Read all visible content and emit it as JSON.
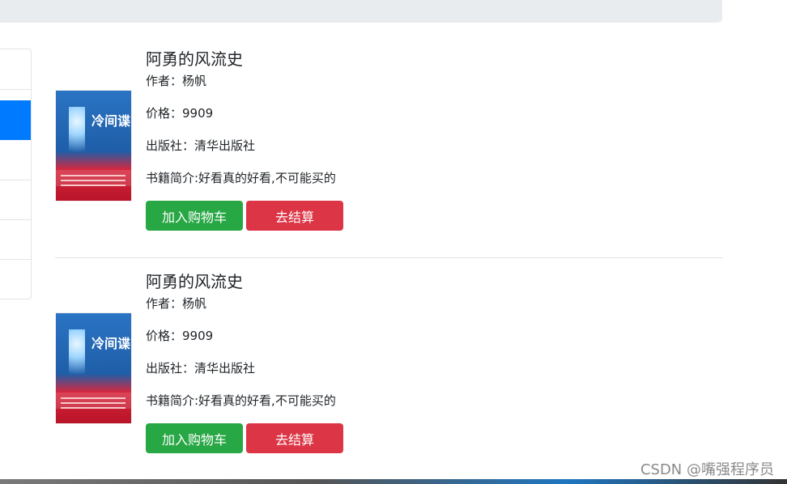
{
  "books": [
    {
      "title": "阿勇的风流史",
      "author": "作者：杨帆",
      "price": "价格：9909",
      "publisher": "出版社：清华出版社",
      "summary": "书籍简介:好看真的好看,不可能买的",
      "cover_title": "冷间谍",
      "buttons": {
        "add_to_cart": "加入购物车",
        "checkout": "去结算"
      }
    },
    {
      "title": "阿勇的风流史",
      "author": "作者：杨帆",
      "price": "价格：9909",
      "publisher": "出版社：清华出版社",
      "summary": "书籍简介:好看真的好看,不可能买的",
      "cover_title": "冷间谍",
      "buttons": {
        "add_to_cart": "加入购物车",
        "checkout": "去结算"
      }
    }
  ],
  "watermark": "CSDN @嘴强程序员",
  "colors": {
    "success": "#28a745",
    "danger": "#dc3545",
    "primary": "#007bff",
    "top_bar": "#e9ecef"
  }
}
